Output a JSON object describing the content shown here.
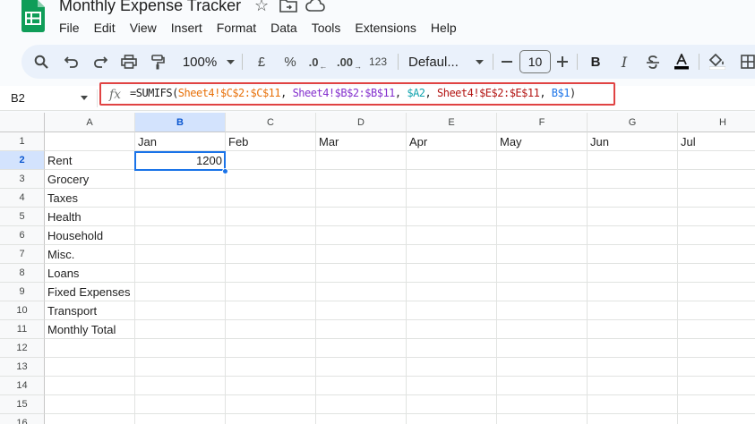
{
  "app": {
    "doc_title": "Monthly Expense Tracker",
    "brand_color": "#0f9d58"
  },
  "menu": [
    "File",
    "Edit",
    "View",
    "Insert",
    "Format",
    "Data",
    "Tools",
    "Extensions",
    "Help"
  ],
  "toolbar": {
    "zoom": "100%",
    "currency": "£",
    "percent": "%",
    "decrease_decimal": ".0",
    "increase_decimal": ".00",
    "more_formats": "123",
    "font_family": "Defaul...",
    "font_size": "10",
    "bold": "B"
  },
  "formula_bar": {
    "cell_ref": "B2",
    "fx_label": "fx",
    "formula": {
      "prefix": "=SUMIFS(",
      "arg1": "Sheet4!$C$2:$C$11",
      "sep1": ", ",
      "arg2": "Sheet4!$B$2:$B$11",
      "sep2": ", ",
      "arg3": "$A2",
      "sep3": ", ",
      "arg4": "Sheet4!$E$2:$E$11",
      "sep4": ", ",
      "arg5": "B$1",
      "suffix": ")"
    }
  },
  "grid": {
    "columns": [
      "A",
      "B",
      "C",
      "D",
      "E",
      "F",
      "G",
      "H"
    ],
    "selected_column": "B",
    "rows": [
      "1",
      "2",
      "3",
      "4",
      "5",
      "6",
      "7",
      "8",
      "9",
      "10",
      "11",
      "12",
      "13",
      "14",
      "15",
      "16"
    ],
    "selected_row": "2",
    "months": [
      "Jan",
      "Feb",
      "Mar",
      "Apr",
      "May",
      "Jun",
      "Jul"
    ],
    "categories": [
      "Rent",
      "Grocery",
      "Taxes",
      "Health",
      "Household",
      "Misc.",
      "Loans",
      "Fixed Expenses",
      "Transport",
      "Monthly Total"
    ],
    "b2_value": "1200"
  }
}
